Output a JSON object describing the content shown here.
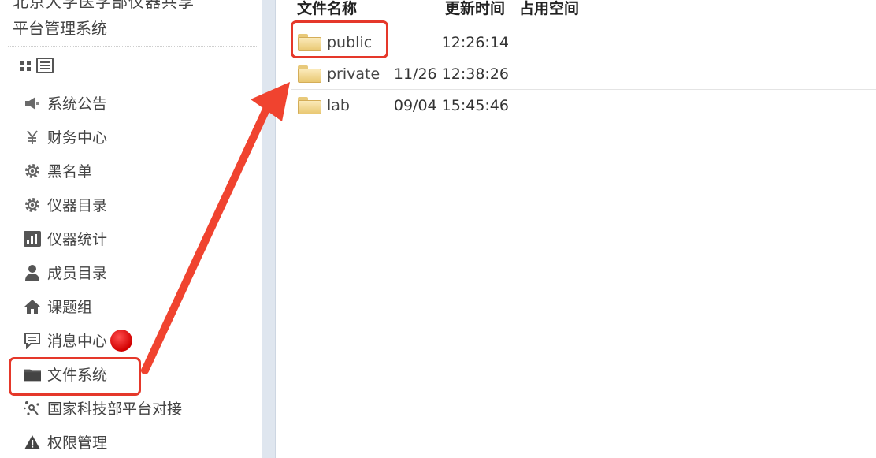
{
  "sidebar": {
    "cutoff_title": "北京大学医学部仪器共享",
    "site_title": "平台管理系统",
    "view_toggle": {
      "grid_icon": "grid-icon",
      "list_icon": "list-icon"
    },
    "menu": [
      {
        "label": "系统公告",
        "icon": "megaphone-icon"
      },
      {
        "label": "财务中心",
        "icon": "yen-icon"
      },
      {
        "label": "黑名单",
        "icon": "gear-icon"
      },
      {
        "label": "仪器目录",
        "icon": "gear-icon"
      },
      {
        "label": "仪器统计",
        "icon": "bar-chart-icon"
      },
      {
        "label": "成员目录",
        "icon": "user-icon"
      },
      {
        "label": "课题组",
        "icon": "home-icon"
      },
      {
        "label": "消息中心",
        "icon": "message-icon",
        "badge": true
      },
      {
        "label": "文件系统",
        "icon": "folder-icon",
        "highlighted": true
      },
      {
        "label": "国家科技部平台对接",
        "icon": "network-icon"
      },
      {
        "label": "权限管理",
        "icon": "warning-icon"
      }
    ]
  },
  "file_panel": {
    "headers": {
      "name": "文件名称",
      "updated": "更新时间",
      "size": "占用空间"
    },
    "rows": [
      {
        "name": "public",
        "updated": "12:26:14",
        "size": "",
        "highlighted": true
      },
      {
        "name": "private",
        "updated": "11/26 12:38:26",
        "size": ""
      },
      {
        "name": "lab",
        "updated": "09/04 15:45:46",
        "size": ""
      }
    ]
  },
  "colors": {
    "highlight": "#e5382a",
    "arrow": "#f0432f",
    "splitter": "#dfe6ef",
    "badge": "#d10000"
  }
}
